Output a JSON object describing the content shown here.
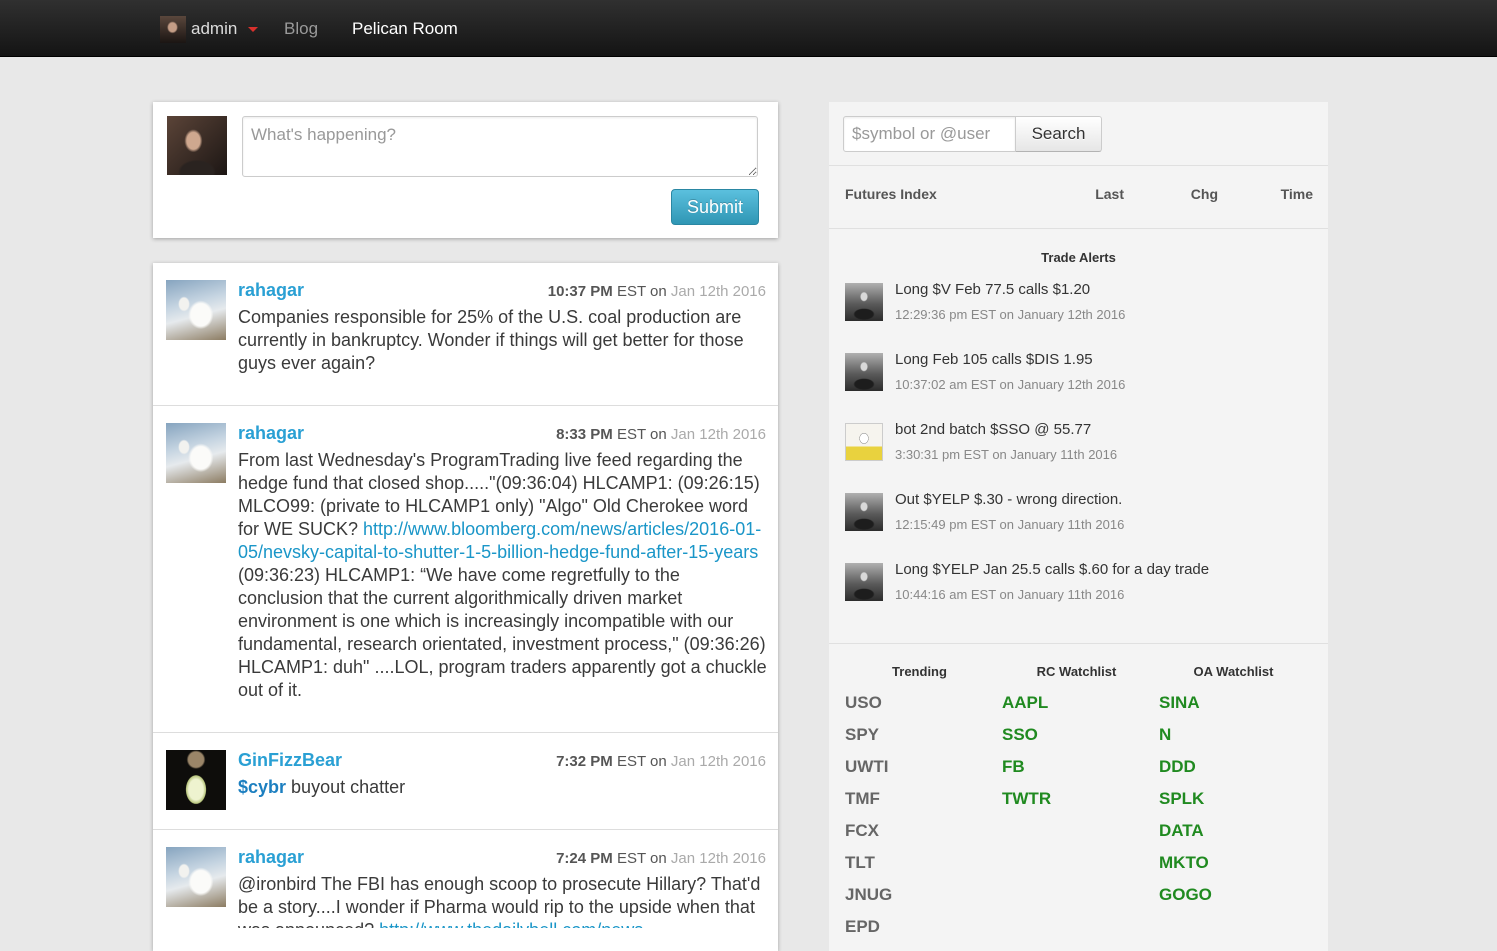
{
  "navbar": {
    "user_label": "admin",
    "links": [
      {
        "label": "Blog"
      },
      {
        "label": "Pelican Room"
      }
    ]
  },
  "composer": {
    "placeholder": "What's happening?",
    "submit_label": "Submit"
  },
  "feed": [
    {
      "username": "rahagar",
      "time": "10:37 PM",
      "time_suffix": "EST on",
      "date": "Jan 12th 2016",
      "body": [
        {
          "text": "Companies responsible for 25% of the U.S. coal production are currently in bankruptcy. Wonder if things will get better for those guys ever again?"
        }
      ]
    },
    {
      "username": "rahagar",
      "time": "8:33 PM",
      "time_suffix": "EST on",
      "date": "Jan 12th 2016",
      "body": [
        {
          "text": "From last Wednesday's ProgramTrading live feed regarding the hedge fund that closed shop.....\"(09:36:04) HLCAMP1: (09:26:15) MLCO99: (private to HLCAMP1 only) \"Algo\" Old Cherokee word for WE SUCK? "
        },
        {
          "text": "http://www.bloomberg.com/news/articles/2016-01-05/nevsky-capital-to-shutter-1-5-billion-hedge-fund-after-15-years",
          "link": true
        },
        {
          "text": " (09:36:23) HLCAMP1: “We have come regretfully to the conclusion that the current algorithmically driven market environment is one which is increasingly incompatible with our fundamental, research orientated, investment process,\" (09:36:26) HLCAMP1: duh\" ....LOL, program traders apparently got a chuckle out of it."
        }
      ]
    },
    {
      "username": "GinFizzBear",
      "time": "7:32 PM",
      "time_suffix": "EST on",
      "date": "Jan 12th 2016",
      "body": [
        {
          "text": "$cybr",
          "link": true
        },
        {
          "text": " buyout chatter"
        }
      ]
    },
    {
      "username": "rahagar",
      "time": "7:24 PM",
      "time_suffix": "EST on",
      "date": "Jan 12th 2016",
      "body": [
        {
          "text": "@ironbird The FBI has enough scoop to prosecute Hillary? That'd be a story....I wonder if Pharma would rip to the upside when that was announced? "
        },
        {
          "text": "http://www.thedailybell.com/news-",
          "link": true
        }
      ]
    }
  ],
  "search": {
    "placeholder": "$symbol or @user",
    "button_label": "Search"
  },
  "futures": {
    "columns": [
      "Futures Index",
      "Last",
      "Chg",
      "Time"
    ]
  },
  "trade_alerts": {
    "title": "Trade Alerts",
    "items": [
      {
        "text": "Long $V Feb 77.5 calls $1.20",
        "time": "12:29:36 pm EST on January 12th 2016"
      },
      {
        "text": "Long Feb 105 calls $DIS 1.95",
        "time": "10:37:02 am EST on January 12th 2016"
      },
      {
        "text": "bot 2nd batch $SSO @ 55.77",
        "time": "3:30:31 pm EST on January 11th 2016"
      },
      {
        "text": "Out $YELP $.30 - wrong direction.",
        "time": "12:15:49 pm EST on January 11th 2016"
      },
      {
        "text": "Long $YELP Jan 25.5 calls $.60 for a day trade",
        "time": "10:44:16 am EST on January 11th 2016"
      }
    ]
  },
  "watchlists": [
    {
      "title": "Trending",
      "symbols": [
        "USO",
        "SPY",
        "UWTI",
        "TMF",
        "FCX",
        "TLT",
        "JNUG",
        "EPD"
      ]
    },
    {
      "title": "RC Watchlist",
      "symbols": [
        "AAPL",
        "SSO",
        "FB",
        "TWTR"
      ]
    },
    {
      "title": "OA Watchlist",
      "symbols": [
        "SINA",
        "N",
        "DDD",
        "SPLK",
        "DATA",
        "MKTO",
        "GOGO"
      ]
    }
  ],
  "colors": {
    "navbar": "#1a1a1a",
    "username_link": "#2aa0d4",
    "submit_blue": "#2f96b4",
    "watchlist_green": "#208a20",
    "trending_gray": "#666666",
    "caret_red": "#d9302c"
  },
  "icons": {
    "user_menu_caret": "caret-down-icon"
  }
}
